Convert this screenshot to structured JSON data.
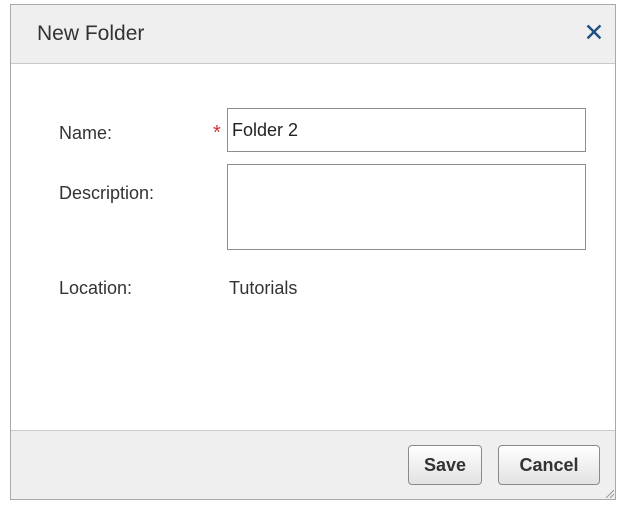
{
  "dialog": {
    "title": "New Folder",
    "close_icon": "close-icon"
  },
  "form": {
    "name_label": "Name:",
    "name_required_marker": "*",
    "name_value": "Folder 2",
    "description_label": "Description:",
    "description_value": "",
    "location_label": "Location:",
    "location_value": "Tutorials"
  },
  "footer": {
    "save_label": "Save",
    "cancel_label": "Cancel"
  },
  "colors": {
    "title_bar": "#efefef",
    "close_icon": "#1f4f82",
    "required_marker": "#d32f2f",
    "input_border": "#8d8d8d"
  }
}
